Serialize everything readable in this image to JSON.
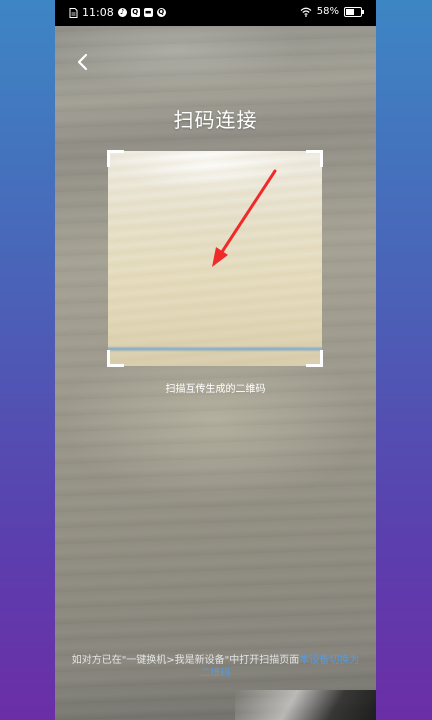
{
  "status_bar": {
    "time": "11:08",
    "app_icons": [
      "music-app",
      "search-app",
      "message-app",
      "qq-app"
    ],
    "battery_percent": "58%",
    "wifi": "wifi-icon"
  },
  "header": {
    "back_icon": "chevron-left-icon",
    "title": "扫码连接"
  },
  "scanner": {
    "hint": "扫描互传生成的二维码"
  },
  "footer": {
    "tip_text": "如对方已在\"一键换机>我是新设备\"中打开扫描页面",
    "tip_link": "本设备切换为二维码"
  },
  "colors": {
    "link": "#4d9cf0",
    "scan_line": "#6ea0cd",
    "annotation_arrow": "#f02a2a"
  }
}
